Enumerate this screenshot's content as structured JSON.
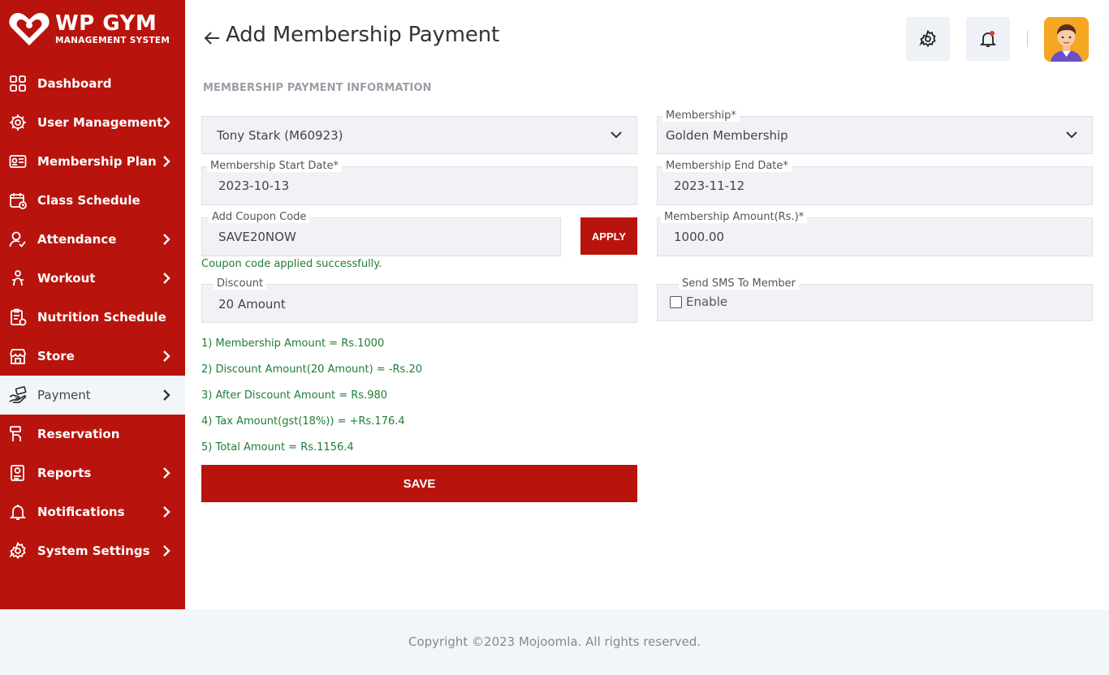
{
  "brand": {
    "name": "WP GYM",
    "subtitle": "MANAGEMENT SYSTEM"
  },
  "sidebar": {
    "items": [
      {
        "label": "Dashboard",
        "icon": "grid-icon",
        "has_submenu": false
      },
      {
        "label": "User Management",
        "icon": "users-cog-icon",
        "has_submenu": true
      },
      {
        "label": "Membership Plan",
        "icon": "id-card-icon",
        "has_submenu": true
      },
      {
        "label": "Class Schedule",
        "icon": "calendar-icon",
        "has_submenu": false
      },
      {
        "label": "Attendance",
        "icon": "user-check-icon",
        "has_submenu": true
      },
      {
        "label": "Workout",
        "icon": "workout-icon",
        "has_submenu": true
      },
      {
        "label": "Nutrition Schedule",
        "icon": "clipboard-icon",
        "has_submenu": false
      },
      {
        "label": "Store",
        "icon": "store-icon",
        "has_submenu": true
      },
      {
        "label": "Payment",
        "icon": "hand-money-icon",
        "has_submenu": true,
        "active": true
      },
      {
        "label": "Reservation",
        "icon": "reservation-icon",
        "has_submenu": false
      },
      {
        "label": "Reports",
        "icon": "report-icon",
        "has_submenu": true
      },
      {
        "label": "Notifications",
        "icon": "bell-icon",
        "has_submenu": true
      },
      {
        "label": "System Settings",
        "icon": "gear-icon",
        "has_submenu": true
      }
    ]
  },
  "header": {
    "title": "Add Membership Payment",
    "back_icon": "arrow-left-icon",
    "settings_icon": "gear-icon",
    "notification_icon": "bell-icon",
    "notification_dot_color": "#e53935"
  },
  "form": {
    "section_title": "MEMBERSHIP PAYMENT INFORMATION",
    "member": {
      "value": "Tony Stark (M60923)"
    },
    "membership": {
      "label": "Membership*",
      "value": "Golden Membership"
    },
    "start_date": {
      "label": "Membership Start Date*",
      "value": "2023-10-13"
    },
    "end_date": {
      "label": "Membership End Date*",
      "value": "2023-11-12"
    },
    "coupon": {
      "label": "Add Coupon Code",
      "value": "SAVE20NOW",
      "apply_label": "APPLY",
      "success_message": "Coupon code applied successfully."
    },
    "amount": {
      "label": "Membership Amount(Rs.)*",
      "value": "1000.00"
    },
    "discount": {
      "label": "Discount",
      "value": "20 Amount"
    },
    "sms": {
      "label": "Send SMS To Member",
      "checkbox_label": "Enable",
      "checked": false
    },
    "summary": [
      "1) Membership Amount = Rs.1000",
      "2) Discount Amount(20 Amount) = -Rs.20",
      "3) After Discount Amount = Rs.980",
      "4) Tax Amount(gst(18%)) = +Rs.176.4",
      "5) Total Amount = Rs.1156.4"
    ],
    "save_label": "SAVE"
  },
  "footer": {
    "copyright": "Copyright ©2023 Mojoomla. All rights reserved."
  },
  "colors": {
    "primary": "#b8140d",
    "success": "#1e7e34",
    "field_bg": "#f0f2f6",
    "footer_bg": "#f3f6f9"
  }
}
